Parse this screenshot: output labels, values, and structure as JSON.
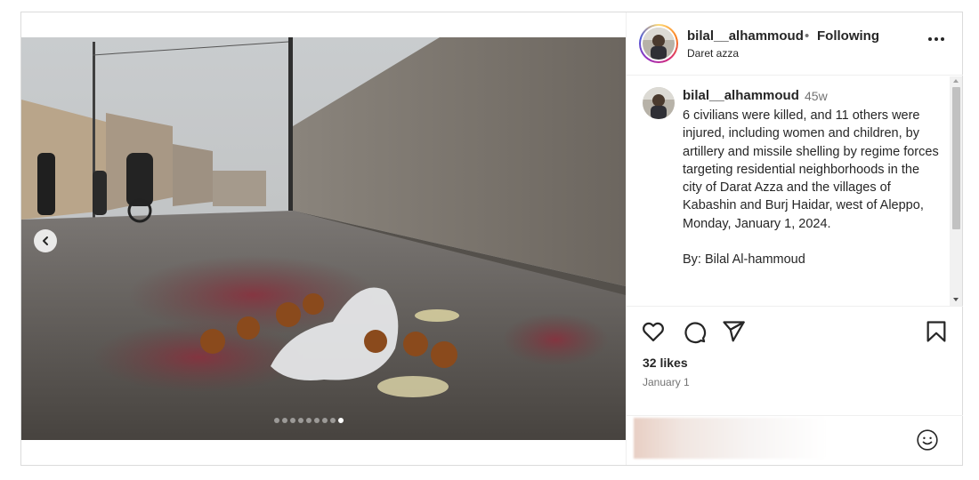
{
  "post": {
    "username": "bilal__alhammoud",
    "separator": "•",
    "follow_status": "Following",
    "location": "Daret azza"
  },
  "caption": {
    "username": "bilal__alhammoud",
    "time_ago": "45w",
    "text": "6 civilians were killed, and 11 others were injured, including women and children, by artillery and missile shelling by regime forces targeting residential neighborhoods in the city of Darat Azza and the villages of Kabashin and Burj Haidar, west of Aleppo, Monday, January 1, 2024.\n\nBy: Bilal Al-hammoud"
  },
  "stats": {
    "likes": "32 likes",
    "date": "January 1"
  },
  "comment": {
    "placeholder": ""
  },
  "carousel": {
    "total_slides": 9,
    "active_slide": 9
  },
  "icons": [
    "previous-icon",
    "more-icon",
    "heart-icon",
    "comment-icon",
    "share-icon",
    "bookmark-icon",
    "emoji-icon"
  ],
  "colors": {
    "text": "#262626",
    "secondary": "#737373",
    "border": "#dbdbdb"
  }
}
